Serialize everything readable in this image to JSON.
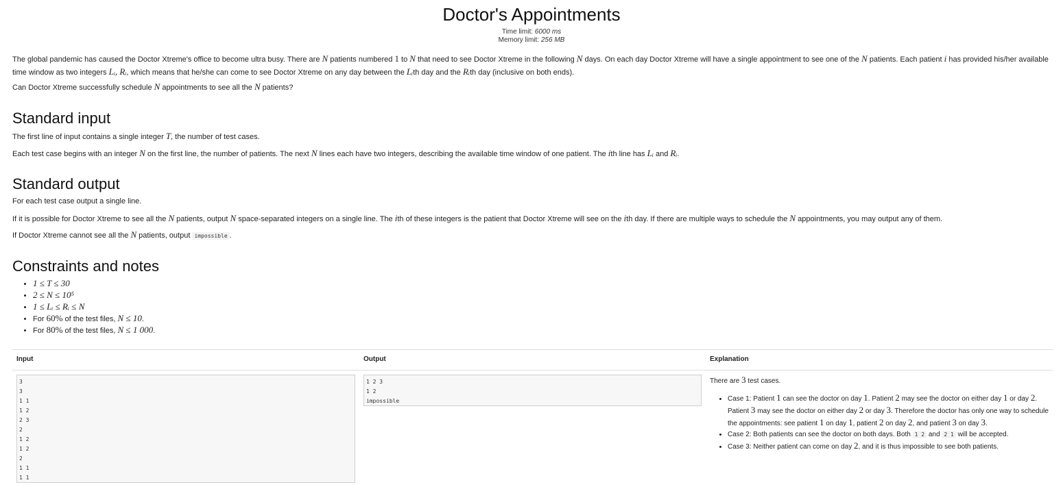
{
  "title": "Doctor's Appointments",
  "limits": {
    "time_label": "Time limit:",
    "time_value": "6000 ms",
    "memory_label": "Memory limit:",
    "memory_value": "256 MB"
  },
  "statement": {
    "p1": {
      "a": "The global pandemic has caused the Doctor Xtreme's office to become ultra busy. There are",
      "N1": "N",
      "b": "patients numbered",
      "one": "1",
      "c": "to",
      "N2": "N",
      "d": "that need to see Doctor Xtreme in the following",
      "N3": "N",
      "e": "days. On each day Doctor Xtreme will have a single appointment to see one of the",
      "N4": "N",
      "f": "patients. Each patient",
      "i": "i",
      "g": "has provided his/her available time window as two integers",
      "Li": "Lᵢ, Rᵢ",
      "h": ", which means that he/she can come to see Doctor Xtreme on any day between the",
      "L": "Lᵢ",
      "j": "th day and the",
      "R": "Rᵢ",
      "k": "th day (inclusive on both ends)."
    },
    "p2": {
      "a": "Can Doctor Xtreme successfully schedule",
      "N1": "N",
      "b": "appointments to see all the",
      "N2": "N",
      "c": "patients?"
    }
  },
  "input_section": {
    "heading": "Standard input",
    "p1": {
      "a": "The first line of input contains a single integer",
      "T": "T",
      "b": ", the number of test cases."
    },
    "p2": {
      "a": "Each test case begins with an integer",
      "N1": "N",
      "b": "on the first line, the number of patients. The next",
      "N2": "N",
      "c": "lines each have two integers, describing the available time window of one patient. The",
      "i": "i",
      "d": "th line has",
      "L": "Lᵢ",
      "e": "and",
      "R": "Rᵢ",
      "f": "."
    }
  },
  "output_section": {
    "heading": "Standard output",
    "p1": "For each test case output a single line.",
    "p2": {
      "a": "If it is possible for Doctor Xtreme to see all the",
      "N1": "N",
      "b": "patients, output",
      "N2": "N",
      "c": "space-separated integers on a single line. The",
      "i1": "i",
      "d": "th of these integers is the patient that Doctor Xtreme will see on the",
      "i2": "i",
      "e": "th day. If there are multiple ways to schedule the",
      "N3": "N",
      "f": "appointments, you may output any of them."
    },
    "p3": {
      "a": "If Doctor Xtreme cannot see all the",
      "N": "N",
      "b": "patients, output",
      "code": "impossible",
      "c": "."
    }
  },
  "constraints": {
    "heading": "Constraints and notes",
    "items": [
      {
        "math": "1 ≤ T ≤ 30"
      },
      {
        "math": "2 ≤ N ≤ 10⁵"
      },
      {
        "math": "1 ≤ Lᵢ ≤ Rᵢ ≤ N"
      },
      {
        "a": "For",
        "pct": "60%",
        "b": "of the test files,",
        "math": "N ≤ 10",
        "c": "."
      },
      {
        "a": "For",
        "pct": "80%",
        "b": "of the test files,",
        "math": "N ≤ 1 000",
        "c": "."
      }
    ]
  },
  "example": {
    "input_header": "Input",
    "output_header": "Output",
    "explanation_header": "Explanation",
    "input_text": "3\n3\n1 1\n1 2\n2 3\n2\n1 2\n1 2\n2\n1 1\n1 1",
    "output_text": "1 2 3\n1 2\nimpossible",
    "explanation": {
      "intro_a": "There are",
      "intro_n": "3",
      "intro_b": "test cases.",
      "case1": {
        "a": "Case 1: Patient",
        "n1": "1",
        "b": "can see the doctor on day",
        "n2": "1",
        "c": ". Patient",
        "n3": "2",
        "d": "may see the doctor on either day",
        "n4": "1",
        "e": "or day",
        "n5": "2",
        "f": ". Patient",
        "n6": "3",
        "g": "may see the doctor on either day",
        "n7": "2",
        "h": "or day",
        "n8": "3",
        "i": ". Therefore the doctor has only one way to schedule the appointments: see patient",
        "n9": "1",
        "j": "on day",
        "n10": "1",
        "k": ", patient",
        "n11": "2",
        "l": "on day",
        "n12": "2",
        "m": ", and patient",
        "n13": "3",
        "n": "on day",
        "n14": "3",
        "o": "."
      },
      "case2": {
        "a": "Case 2: Both patients can see the doctor on both days. Both",
        "code1": "1 2",
        "b": "and",
        "code2": "2 1",
        "c": "will be accepted."
      },
      "case3": {
        "a": "Case 3: Neither patient can come on day",
        "n": "2",
        "b": ", and it is thus impossible to see both patients."
      }
    }
  }
}
